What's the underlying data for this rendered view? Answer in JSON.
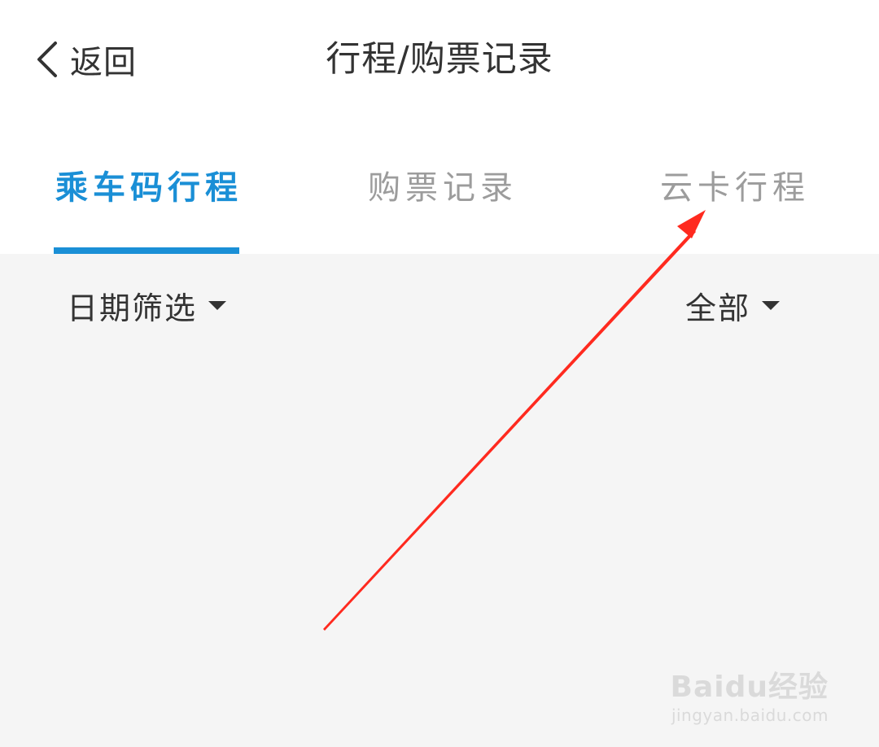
{
  "header": {
    "back_label": "返回",
    "title": "行程/购票记录"
  },
  "tabs": [
    {
      "label": "乘车码行程",
      "active": true
    },
    {
      "label": "购票记录",
      "active": false
    },
    {
      "label": "云卡行程",
      "active": false
    }
  ],
  "filters": {
    "date_label": "日期筛选",
    "status_label": "全部"
  },
  "watermark": {
    "logo": "Baidu经验",
    "url": "jingyan.baidu.com"
  },
  "colors": {
    "accent": "#1a8fd6",
    "annotation_arrow": "#ff2a1f",
    "background": "#f5f5f5"
  },
  "icons": {
    "back": "chevron-left-icon",
    "dropdown": "caret-down-icon"
  }
}
